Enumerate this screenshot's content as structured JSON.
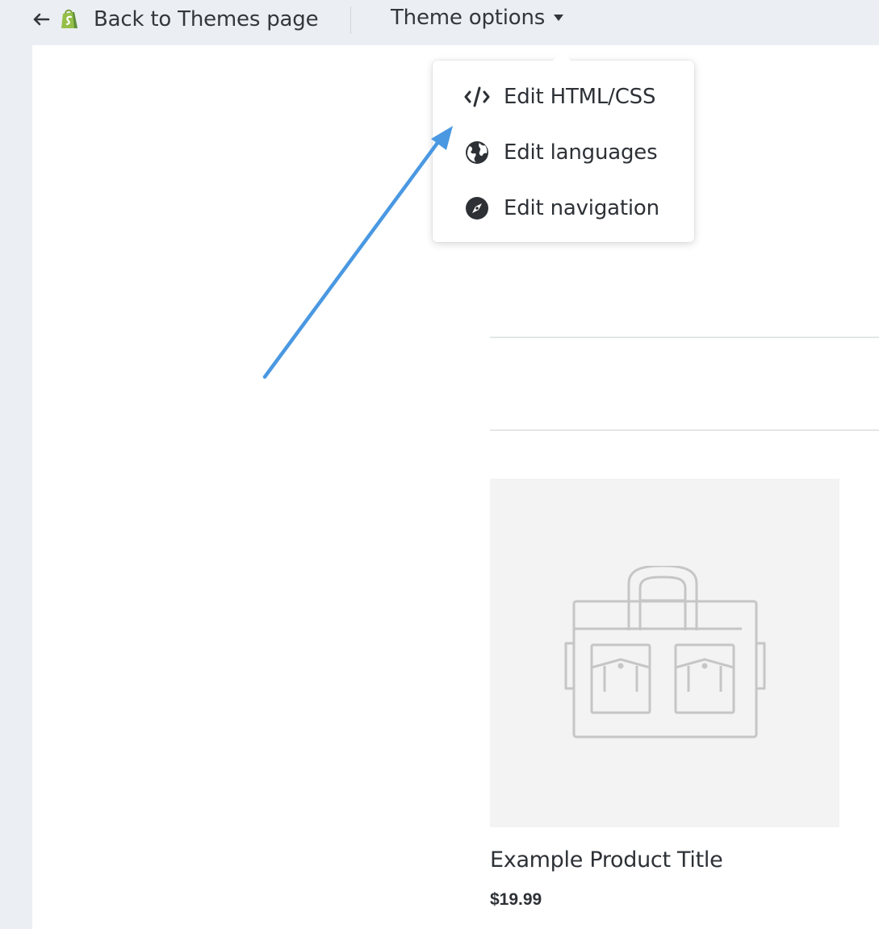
{
  "topbar": {
    "back_label": "Back to Themes page",
    "theme_options_label": "Theme options",
    "brand_color": "#95bf47"
  },
  "dropdown": {
    "items": [
      {
        "label": "Edit HTML/CSS",
        "icon": "code-icon"
      },
      {
        "label": "Edit languages",
        "icon": "globe-icon"
      },
      {
        "label": "Edit navigation",
        "icon": "compass-icon"
      }
    ]
  },
  "product": {
    "title": "Example Product Title",
    "price": "$19.99",
    "image_icon": "bag-icon"
  },
  "annotation": {
    "arrow_color": "#4a98e2"
  }
}
